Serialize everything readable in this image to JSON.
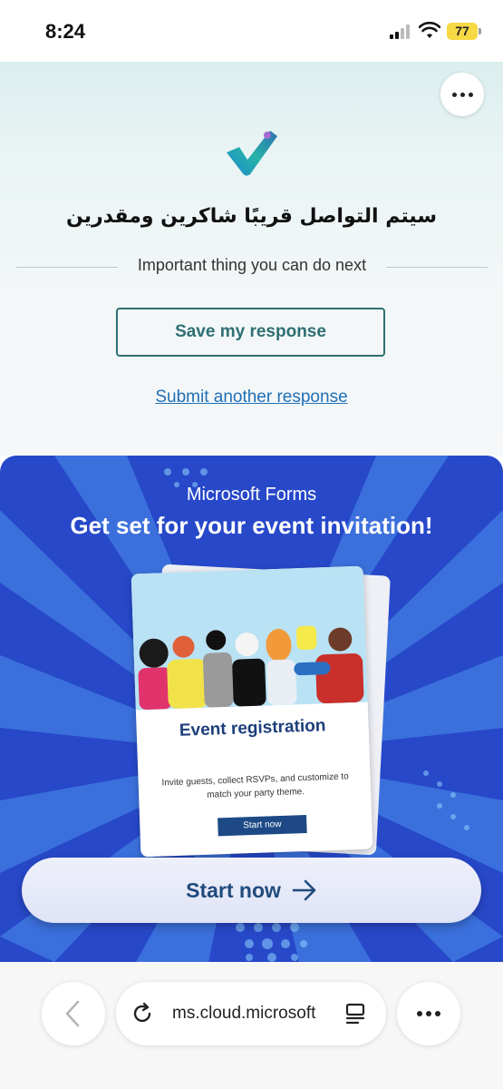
{
  "status_bar": {
    "time": "8:24",
    "battery": "77"
  },
  "confirmation": {
    "message": "سيتم التواصل قريبًا شاكرين ومقدرين",
    "divider_text": "Important thing you can do next",
    "save_label": "Save my response",
    "submit_another_label": "Submit another response"
  },
  "promo": {
    "brand": "Microsoft Forms",
    "title": "Get set for your event invitation!",
    "card": {
      "title": "Event registration",
      "description": "Invite guests, collect RSVPs, and customize to match your party theme.",
      "button": "Start now"
    },
    "cta_label": "Start now"
  },
  "browser": {
    "url": "ms.cloud.microsoft"
  },
  "colors": {
    "accent": "#2e6f73",
    "link": "#1f6fb6",
    "promo_bg": "#2748c9",
    "cta_text": "#1f4a7c"
  }
}
